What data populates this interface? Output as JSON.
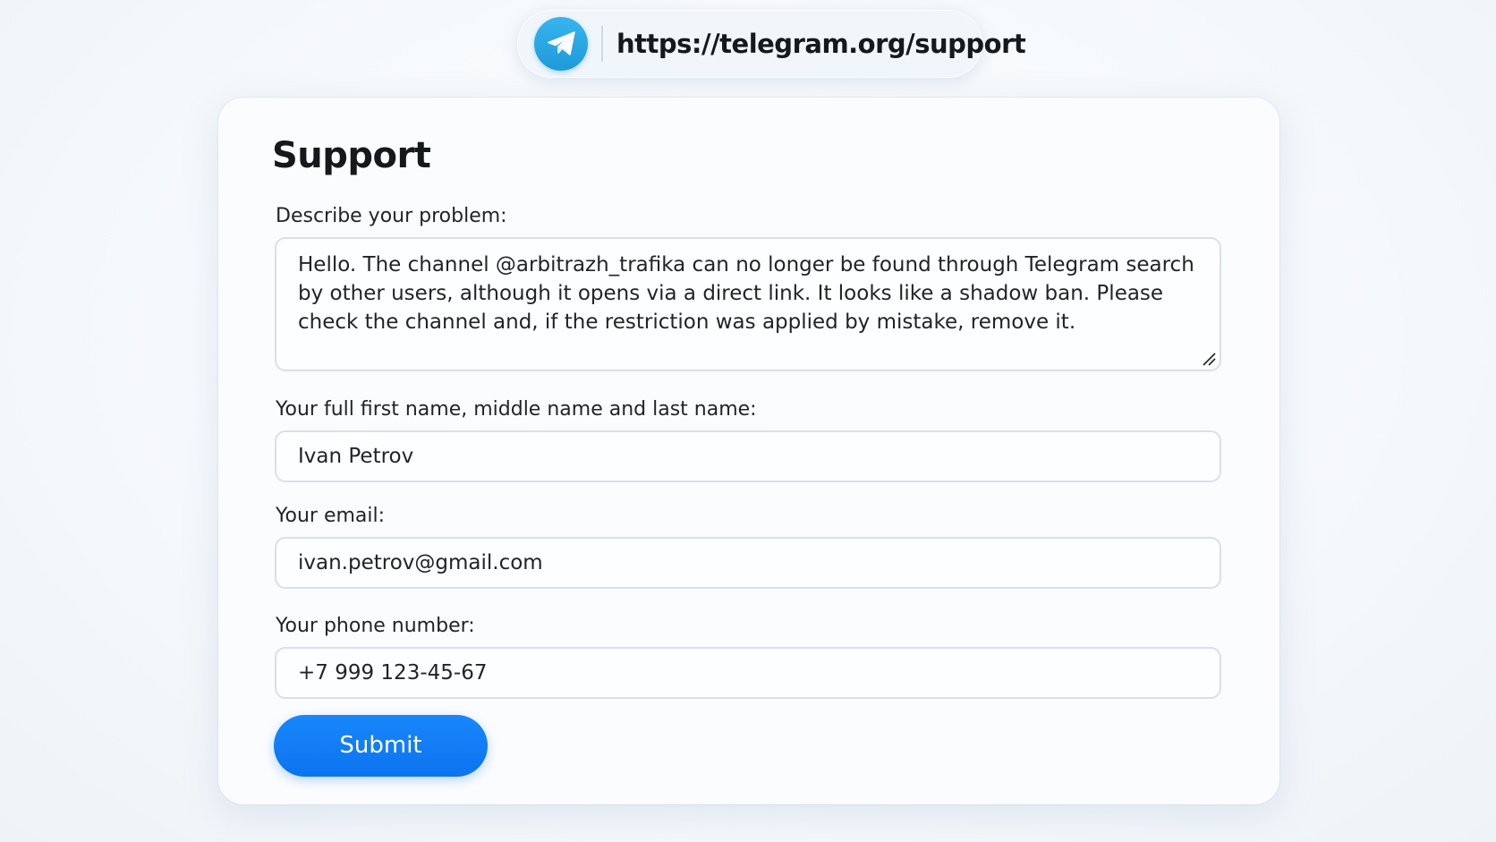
{
  "address_bar": {
    "url": "https://telegram.org/support",
    "logo_icon": "telegram-icon"
  },
  "form": {
    "title": "Support",
    "problem_label": "Describe your problem:",
    "problem_value": "Hello. The channel @arbitrazh_trafika can no longer be found through Telegram search by other users, although it opens via a direct link. It looks like a shadow ban. Please check the channel and, if the restriction was applied by mistake, remove it.",
    "name_label": "Your full first name, middle name and last name:",
    "name_value": "Ivan Petrov",
    "email_label": "Your email:",
    "email_value": "ivan.petrov@gmail.com",
    "phone_label": "Your phone number:",
    "phone_value": "+7 999 123-45-67",
    "submit_label": "Submit"
  },
  "colors": {
    "accent": "#0a74ef",
    "telegram_blue": "#2aa3e3"
  }
}
